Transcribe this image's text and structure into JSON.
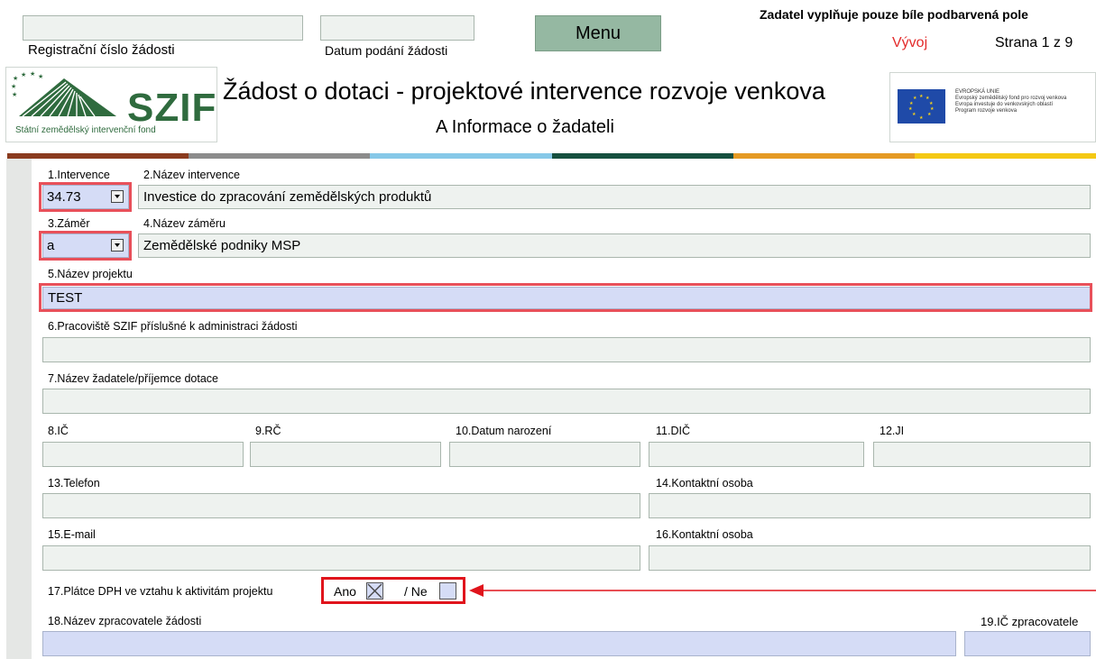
{
  "header": {
    "reg_label": "Registrační číslo žádosti",
    "date_label": "Datum podání žádosti",
    "menu_label": "Menu",
    "notice": "Zadatel vyplňuje pouze bíle podbarvená pole",
    "status": "Vývoj",
    "page": "Strana 1 z 9"
  },
  "logo": {
    "text": "SZIF",
    "subtitle": "Státní zemědělský intervenční fond"
  },
  "title": {
    "main": "Žádost o dotaci - projektové intervence rozvoje venkova",
    "sub": "A Informace o žadateli"
  },
  "eu": {
    "line1": "EVROPSKÁ UNIE",
    "line2": "Evropský zemědělský fond pro rozvoj venkova",
    "line3": "Evropa investuje do venkovských oblastí",
    "line4": "Program rozvoje venkova"
  },
  "colors": {
    "stripe": [
      "#8a3b1f",
      "#8c8c8c",
      "#86c8e8",
      "#16503f",
      "#e59a24",
      "#f4c814"
    ],
    "highlight": "#e8505a"
  },
  "form": {
    "f1": {
      "label": "1.Intervence",
      "value": "34.73"
    },
    "f2": {
      "label": "2.Název intervence",
      "value": "Investice do zpracování zemědělských produktů"
    },
    "f3": {
      "label": "3.Záměr",
      "value": "a"
    },
    "f4": {
      "label": "4.Název záměru",
      "value": "Zemědělské podniky MSP"
    },
    "f5": {
      "label": "5.Název projektu",
      "value": "TEST"
    },
    "f6": {
      "label": "6.Pracoviště SZIF příslušné k administraci žádosti"
    },
    "f7": {
      "label": "7.Název žadatele/příjemce dotace"
    },
    "f8": {
      "label": "8.IČ"
    },
    "f9": {
      "label": "9.RČ"
    },
    "f10": {
      "label": "10.Datum narození"
    },
    "f11": {
      "label": "11.DIČ"
    },
    "f12": {
      "label": "12.JI"
    },
    "f13": {
      "label": "13.Telefon"
    },
    "f14": {
      "label": "14.Kontaktní osoba"
    },
    "f15": {
      "label": "15.E-mail"
    },
    "f16": {
      "label": "16.Kontaktní osoba"
    },
    "f17": {
      "label": "17.Plátce DPH ve vztahu k aktivitám projektu",
      "yes": "Ano",
      "no": "/ Ne",
      "yes_checked": true,
      "no_checked": false
    },
    "f18": {
      "label": "18.Název zpracovatele žádosti"
    },
    "f19": {
      "label": "19.IČ zpracovatele"
    }
  }
}
